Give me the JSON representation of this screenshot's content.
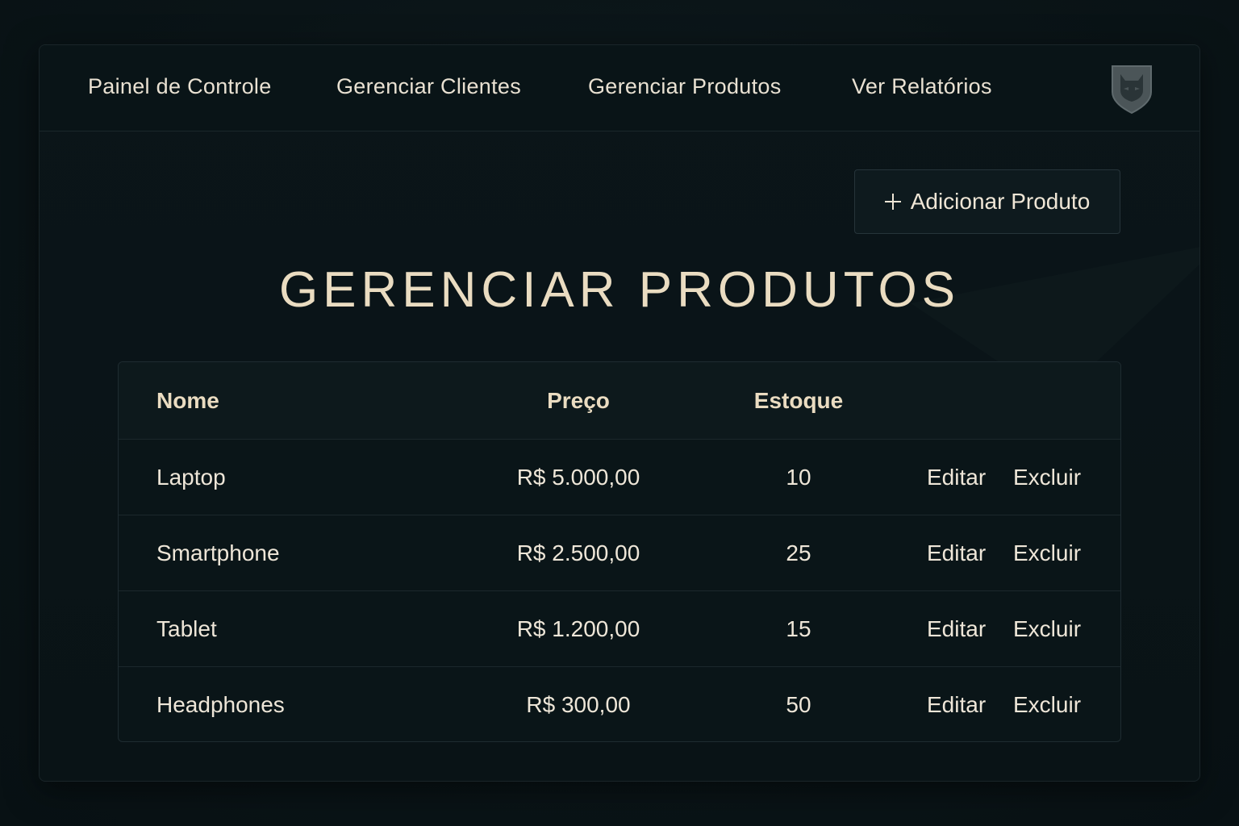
{
  "nav": {
    "items": [
      {
        "label": "Painel de Controle"
      },
      {
        "label": "Gerenciar Clientes"
      },
      {
        "label": "Gerenciar Produtos"
      },
      {
        "label": "Ver Relatórios"
      }
    ],
    "logo_icon": "shield-cat-icon"
  },
  "toolbar": {
    "add_label": "Adicionar Produto",
    "add_icon": "plus-icon"
  },
  "page": {
    "title": "GERENCIAR PRODUTOS"
  },
  "table": {
    "headers": {
      "name": "Nome",
      "price": "Preço",
      "stock": "Estoque"
    },
    "rows": [
      {
        "name": "Laptop",
        "price": "R$ 5.000,00",
        "stock": "10",
        "edit": "Editar",
        "delete": "Excluir"
      },
      {
        "name": "Smartphone",
        "price": "R$ 2.500,00",
        "stock": "25",
        "edit": "Editar",
        "delete": "Excluir"
      },
      {
        "name": "Tablet",
        "price": "R$ 1.200,00",
        "stock": "15",
        "edit": "Editar",
        "delete": "Excluir"
      },
      {
        "name": "Headphones",
        "price": "R$ 300,00",
        "stock": "50",
        "edit": "Editar",
        "delete": "Excluir"
      }
    ]
  },
  "colors": {
    "background": "#0a1417",
    "text": "#eee6d8",
    "accent": "#eadcc1",
    "border": "#1f2c31"
  }
}
